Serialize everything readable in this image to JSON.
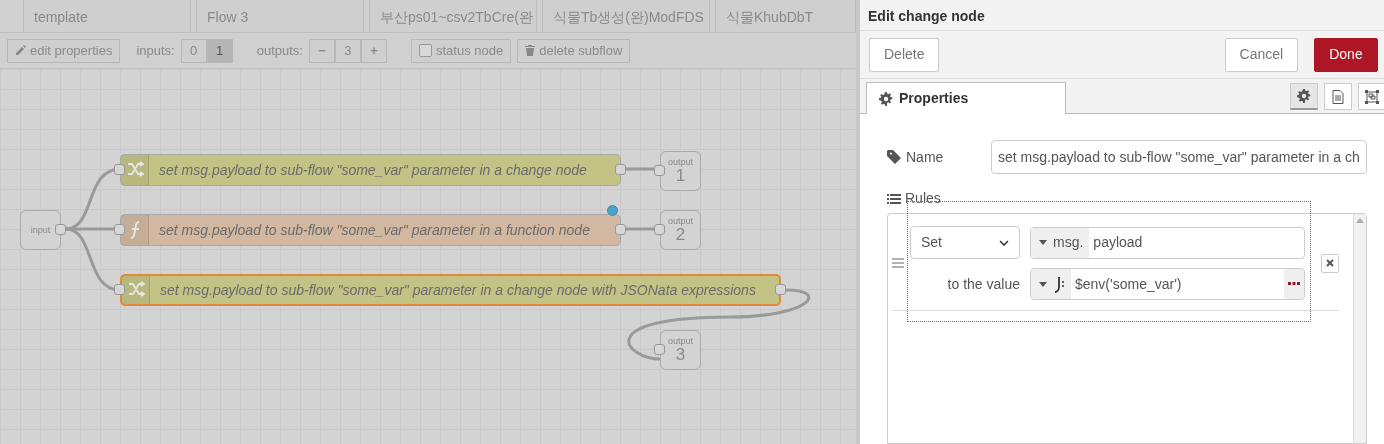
{
  "workspace_tabs": [
    {
      "label": "template"
    },
    {
      "label": "Flow 3"
    },
    {
      "label": "부산ps01~csv2TbCre(완"
    },
    {
      "label": "식물Tb생성(완)ModFDS"
    },
    {
      "label": "식물KhubDbT"
    }
  ],
  "subflow_toolbar": {
    "edit_properties": "edit properties",
    "inputs_label": "inputs:",
    "inputs": [
      {
        "label": "0",
        "selected": false
      },
      {
        "label": "1",
        "selected": true
      }
    ],
    "outputs_label": "outputs:",
    "outputs_minus": "−",
    "outputs_count": "3",
    "outputs_plus": "+",
    "status_node": {
      "label": "status node",
      "checked": false
    },
    "delete_subflow": "delete subflow"
  },
  "flow_nodes": [
    {
      "kind": "change",
      "label": "set msg.payload to sub-flow \"some_var\" parameter in a change node",
      "changed": false,
      "selected": false
    },
    {
      "kind": "function",
      "label": "set msg.payload to sub-flow \"some_var\" parameter in a function node",
      "changed": true,
      "selected": false
    },
    {
      "kind": "change",
      "label": "set msg.payload to sub-flow \"some_var\" parameter in a change node with JSONata expressions",
      "changed": false,
      "selected": true
    },
    {
      "kind": "input",
      "label": "input",
      "changed": false,
      "selected": false
    },
    {
      "kind": "output",
      "label": "output",
      "number": "1",
      "changed": false,
      "selected": false
    },
    {
      "kind": "output",
      "label": "output",
      "number": "2",
      "changed": false,
      "selected": false
    },
    {
      "kind": "output",
      "label": "output",
      "number": "3",
      "changed": false,
      "selected": false
    }
  ],
  "editor": {
    "title": "Edit change node",
    "buttons": {
      "delete": "Delete",
      "cancel": "Cancel",
      "done": "Done"
    },
    "tabs": [
      {
        "label": "Properties",
        "selected": true
      }
    ],
    "view_buttons": [
      {
        "kind": "properties",
        "selected": true
      },
      {
        "kind": "description",
        "selected": false
      },
      {
        "kind": "appearance",
        "selected": false
      }
    ],
    "name_label": "Name",
    "name_value": "set msg.payload to sub-flow \"some_var\" parameter in a ch",
    "rules_label": "Rules",
    "rules": [
      {
        "action": "Set",
        "target_type": "msg.",
        "target": "payload",
        "to_label": "to the value",
        "value": "$env('some_var')"
      }
    ]
  }
}
